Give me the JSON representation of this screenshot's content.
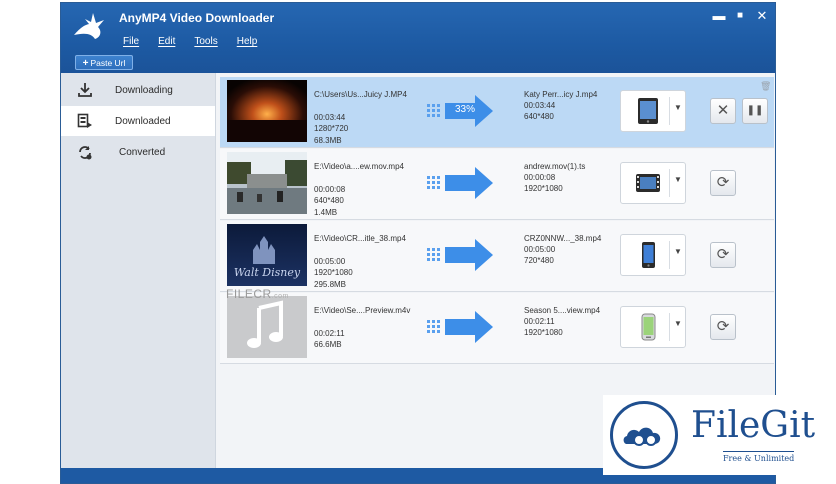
{
  "app": {
    "title": "AnyMP4 Video Downloader"
  },
  "window_controls": {
    "minimize": "▬",
    "maximize": "■",
    "close": "✕"
  },
  "menu": [
    "File",
    "Edit",
    "Tools",
    "Help"
  ],
  "toolbar": {
    "paste_label": "Paste Url",
    "paste_icon": "+"
  },
  "sidebar": {
    "items": [
      {
        "label": "Downloading",
        "icon": "download-icon"
      },
      {
        "label": "Downloaded",
        "icon": "film-list-icon"
      },
      {
        "label": "Converted",
        "icon": "convert-icon"
      }
    ]
  },
  "rows": [
    {
      "source": {
        "name": "C:\\Users\\Us...Juicy J.MP4",
        "duration": "00:03:44",
        "resolution": "1280*720",
        "size": "68.3MB"
      },
      "progress": "33%",
      "output": {
        "name": "Katy Perr...icy J.mp4",
        "duration": "00:03:44",
        "resolution": "640*480"
      },
      "device": "tablet-icon",
      "actions": [
        "✕",
        "❚❚"
      ]
    },
    {
      "source": {
        "name": "E:\\Video\\a....ew.mov.mp4",
        "duration": "00:00:08",
        "resolution": "640*480",
        "size": "1.4MB"
      },
      "progress": "",
      "output": {
        "name": "andrew.mov(1).ts",
        "duration": "00:00:08",
        "resolution": "1920*1080"
      },
      "device": "hd-film-icon",
      "actions": [
        "⟳"
      ]
    },
    {
      "source": {
        "name": "E:\\Video\\CR...itle_38.mp4",
        "duration": "00:05:00",
        "resolution": "1920*1080",
        "size": "295.8MB"
      },
      "progress": "",
      "output": {
        "name": "CRZ0NNW..._38.mp4",
        "duration": "00:05:00",
        "resolution": "720*480"
      },
      "device": "phone-icon",
      "actions": [
        "⟳"
      ]
    },
    {
      "source": {
        "name": "E:\\Video\\Se....Preview.m4v",
        "duration": "00:02:11",
        "resolution": "",
        "size": "66.6MB"
      },
      "progress": "",
      "output": {
        "name": "Season 5....view.mp4",
        "duration": "00:02:11",
        "resolution": "1920*1080"
      },
      "device": "android-phone-icon",
      "actions": [
        "⟳"
      ]
    }
  ],
  "watermarks": {
    "filecr": "FILECR",
    "filecr_suffix": ".com",
    "filegit_name": "FileGit",
    "filegit_tagline": "Free & Unlimited"
  },
  "colors": {
    "titlebar": "#1d5aa3",
    "active_row": "#bcd9f5",
    "arrow": "#3d8ee8",
    "brand_filegit": "#1f4f8f"
  }
}
